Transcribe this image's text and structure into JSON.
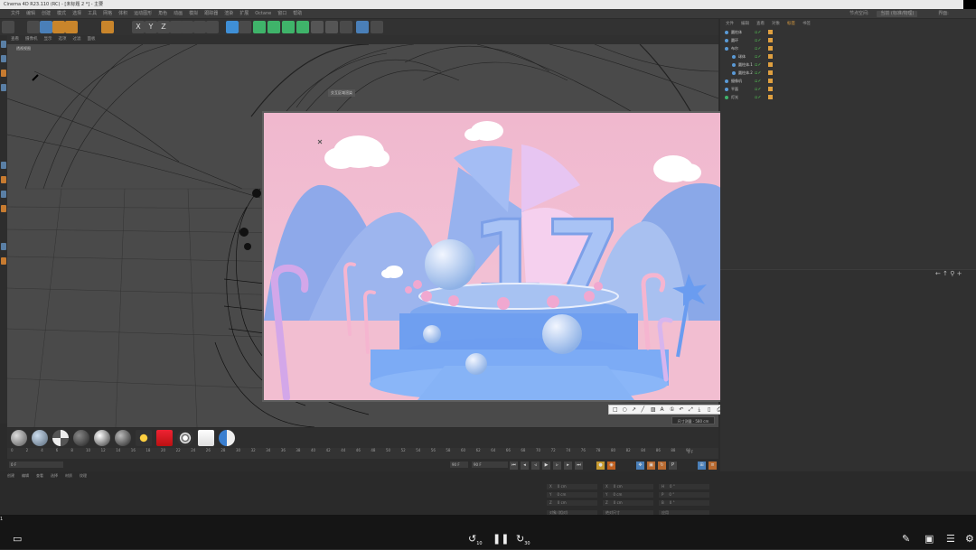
{
  "window": {
    "title": "Cinema 4D R23.110 (RC) - [未标题 2 *] - 主要"
  },
  "menu": {
    "items": [
      "文件",
      "编辑",
      "创建",
      "模式",
      "选择",
      "工具",
      "网格",
      "体积",
      "运动图形",
      "角色",
      "动画",
      "模拟",
      "跟踪器",
      "渲染",
      "扩展",
      "Octane",
      "窗口",
      "帮助"
    ],
    "right": [
      "节点空间:",
      "当前 (标准/物理)",
      "界面:",
      "启动"
    ]
  },
  "toolbar": {
    "icons": [
      "undo-icon",
      "select-icon",
      "move-icon",
      "scale-icon",
      "rotate-icon",
      "add-icon",
      "x-axis-icon",
      "y-axis-icon",
      "z-axis-icon",
      "coord-icon",
      "render-view-icon",
      "render-icon",
      "render-settings-icon",
      "cube-icon",
      "pen-icon",
      "subdivision-icon",
      "cloner-icon",
      "deformer-icon",
      "environment-icon",
      "camera-icon",
      "light-icon",
      "grid-icon",
      "octane-icon",
      "bulb-icon"
    ],
    "x_label": "X",
    "y_label": "Y",
    "z_label": "Z"
  },
  "viewport": {
    "menu": [
      "查看",
      "摄像机",
      "显示",
      "选项",
      "过滤",
      "面板"
    ],
    "label": "透视视图"
  },
  "ir_window": {
    "title": "交互区域渲染",
    "number": "17"
  },
  "snip_tool": {
    "tools": [
      "□",
      "○",
      "↗",
      "╱",
      "▨",
      "A",
      "①",
      "↶",
      "⤢",
      "⤓",
      "▯",
      "⎙",
      "✕",
      "✓"
    ],
    "done_label": "完成",
    "size_tip": "尺寸测量 · 580 cm"
  },
  "materials": {
    "count": 12
  },
  "timeline": {
    "ticks": [
      "0",
      "2",
      "4",
      "6",
      "8",
      "10",
      "12",
      "14",
      "16",
      "18",
      "20",
      "22",
      "24",
      "26",
      "28",
      "30",
      "32",
      "34",
      "36",
      "38",
      "40",
      "42",
      "44",
      "46",
      "48",
      "50",
      "52",
      "54",
      "56",
      "58",
      "60",
      "62",
      "64",
      "66",
      "68",
      "70",
      "72",
      "74",
      "76",
      "78",
      "80",
      "82",
      "84",
      "86",
      "88",
      "90"
    ],
    "end_frame": "0 F"
  },
  "playbar": {
    "start": "0 F",
    "field2": "0 F",
    "end1": "90 F",
    "end2": "90 F"
  },
  "material_tabs": [
    "创建",
    "编辑",
    "查看",
    "选择",
    "材质",
    "纹理"
  ],
  "coords": {
    "rows": [
      [
        "X",
        "0 cm",
        "X",
        "0 cm",
        "H",
        "0 °"
      ],
      [
        "Y",
        "0 cm",
        "Y",
        "0 cm",
        "P",
        "0 °"
      ],
      [
        "Z",
        "0 cm",
        "Z",
        "0 cm",
        "B",
        "0 °"
      ]
    ],
    "mode": "对象 (相对)",
    "size_mode": "绝对尺寸",
    "apply": "应用"
  },
  "object_manager": {
    "tabs": [
      "文件",
      "编辑",
      "查看",
      "对象",
      "标签",
      "书签"
    ],
    "objects": [
      "圆柱体",
      "圆环",
      "布尔",
      "球体",
      "圆柱体.1",
      "圆柱体.2",
      "摄像机",
      "平面",
      "灯光"
    ]
  },
  "video": {
    "time": "1",
    "rewind_label": "10",
    "forward_label": "30"
  },
  "colors": {
    "accent": "#5a9ad6",
    "panel": "#333333",
    "viewport": "#4a4a4a",
    "scene_pink": "#f3bccf",
    "scene_blue": "#8eb4f0"
  }
}
